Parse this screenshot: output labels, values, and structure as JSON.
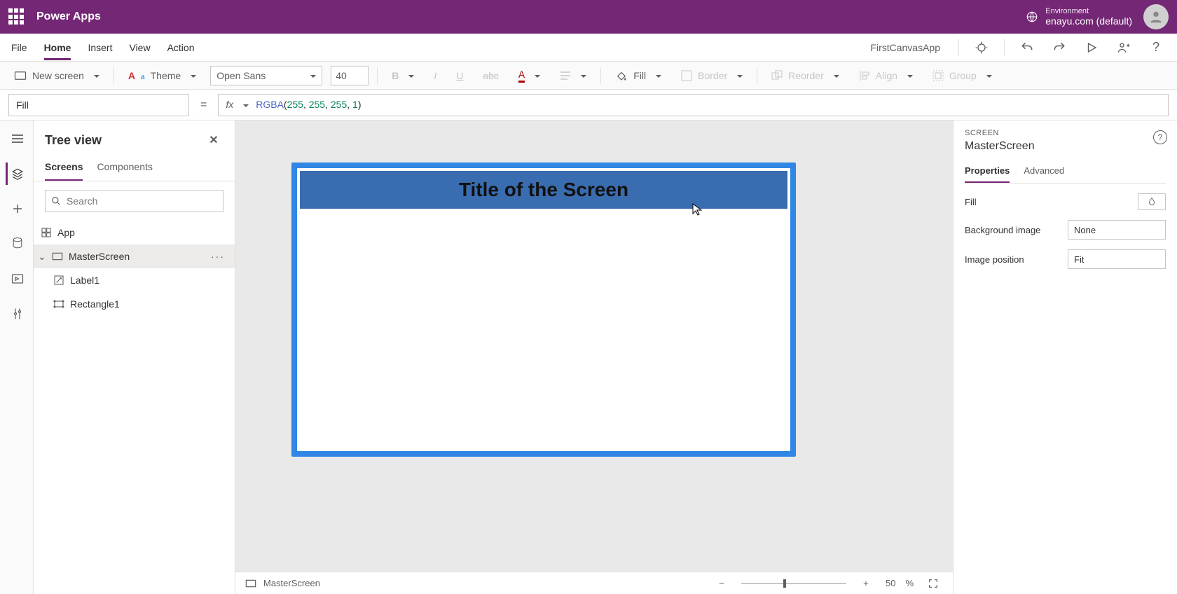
{
  "header": {
    "product": "Power Apps",
    "env_label": "Environment",
    "env_name": "enayu.com (default)"
  },
  "menu": {
    "items": [
      "File",
      "Home",
      "Insert",
      "View",
      "Action"
    ],
    "active": "Home",
    "app_name": "FirstCanvasApp"
  },
  "ribbon": {
    "new_screen": "New screen",
    "theme": "Theme",
    "font": "Open Sans",
    "size": "40",
    "fill": "Fill",
    "border": "Border",
    "reorder": "Reorder",
    "align": "Align",
    "group": "Group"
  },
  "formula": {
    "property": "Fill",
    "fx": "fx",
    "expr_fn": "RGBA",
    "expr_open": "(",
    "expr_n1": "255",
    "expr_c": ", ",
    "expr_n2": "255",
    "expr_n3": "255",
    "expr_n4": "1",
    "expr_close": ")"
  },
  "tree": {
    "title": "Tree view",
    "tabs": {
      "screens": "Screens",
      "components": "Components"
    },
    "search_placeholder": "Search",
    "app": "App",
    "screen": "MasterScreen",
    "label": "Label1",
    "rect": "Rectangle1"
  },
  "canvas": {
    "title_text": "Title of the Screen"
  },
  "status": {
    "screen": "MasterScreen",
    "zoom_value": "50",
    "zoom_pct": "%"
  },
  "props": {
    "kicker": "SCREEN",
    "name": "MasterScreen",
    "tabs": {
      "properties": "Properties",
      "advanced": "Advanced"
    },
    "fill_label": "Fill",
    "bg_label": "Background image",
    "bg_value": "None",
    "pos_label": "Image position",
    "pos_value": "Fit"
  }
}
